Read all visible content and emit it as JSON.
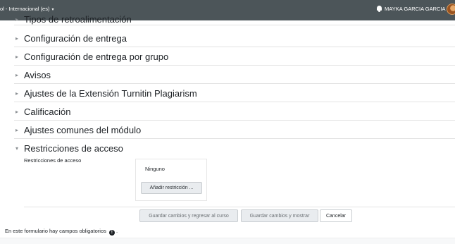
{
  "topbar": {
    "language_label": "ol - Internacional (es)",
    "language_caret": "▾",
    "username": "MAYKA GARCIA GARCIA"
  },
  "sections": [
    {
      "label": "Tipos de retroalimentación",
      "expanded": false
    },
    {
      "label": "Configuración de entrega",
      "expanded": false
    },
    {
      "label": "Configuración de entrega por grupo",
      "expanded": false
    },
    {
      "label": "Avisos",
      "expanded": false
    },
    {
      "label": "Ajustes de la Extensión Turnitin Plagiarism",
      "expanded": false
    },
    {
      "label": "Calificación",
      "expanded": false
    },
    {
      "label": "Ajustes comunes del módulo",
      "expanded": false
    },
    {
      "label": "Restricciones de acceso",
      "expanded": true
    }
  ],
  "restrictions": {
    "field_label": "Restricciones de acceso",
    "current_value": "Ninguno",
    "add_button": "Añadir restricción ..."
  },
  "actions": {
    "save_return": "Guardar cambios y regresar al curso",
    "save_show": "Guardar cambios y mostrar",
    "cancel": "Cancelar"
  },
  "footer": {
    "required_note": "En este formulario hay campos obligatorios",
    "required_suffix": "."
  },
  "icons": {
    "collapsed": "▸",
    "expanded": "▾",
    "info": "!"
  },
  "colors": {
    "topbar_bg": "#4c5559",
    "button_bg": "#e9ecef"
  }
}
